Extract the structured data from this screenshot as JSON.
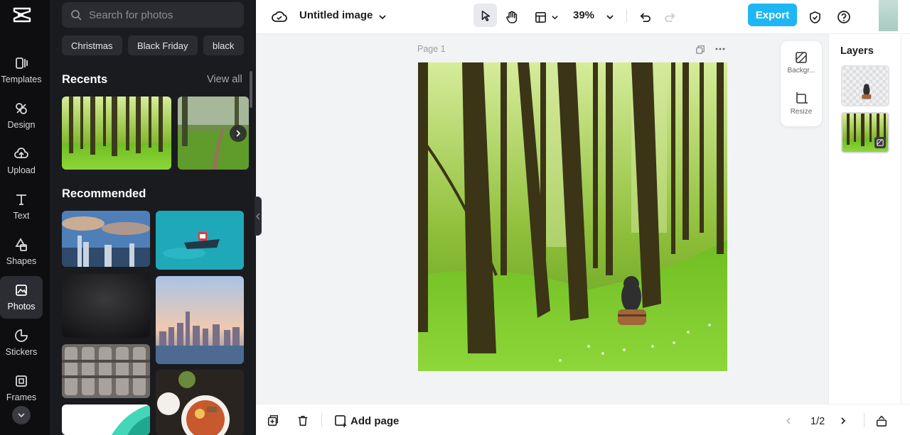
{
  "rail": {
    "items": [
      {
        "label": "Templates",
        "icon": "templates-icon"
      },
      {
        "label": "Design",
        "icon": "design-icon"
      },
      {
        "label": "Upload",
        "icon": "upload-icon"
      },
      {
        "label": "Text",
        "icon": "text-icon"
      },
      {
        "label": "Shapes",
        "icon": "shapes-icon"
      },
      {
        "label": "Photos",
        "icon": "photos-icon"
      },
      {
        "label": "Stickers",
        "icon": "stickers-icon"
      },
      {
        "label": "Frames",
        "icon": "frames-icon"
      }
    ],
    "active": "Photos"
  },
  "panel": {
    "search_placeholder": "Search for photos",
    "chips": [
      "Christmas",
      "Black Friday",
      "black"
    ],
    "recents_title": "Recents",
    "view_all": "View all",
    "recommended_title": "Recommended"
  },
  "topbar": {
    "title": "Untitled image",
    "zoom": "39%",
    "export_label": "Export"
  },
  "canvas": {
    "page_label": "Page 1"
  },
  "float_tools": {
    "background_label": "Backgr...",
    "resize_label": "Resize"
  },
  "layers": {
    "title": "Layers"
  },
  "bottombar": {
    "add_page_label": "Add page",
    "page_count": "1/2"
  },
  "colors": {
    "accent": "#1fb6f5",
    "rail_bg": "#0e0e11",
    "panel_bg": "#1a1b1f"
  }
}
